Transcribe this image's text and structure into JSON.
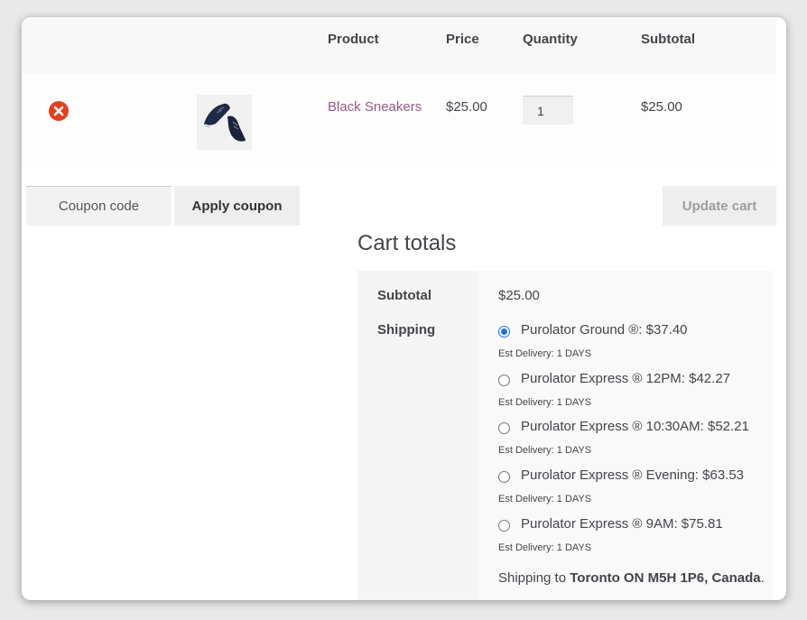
{
  "table": {
    "headers": {
      "product": "Product",
      "price": "Price",
      "quantity": "Quantity",
      "subtotal": "Subtotal"
    },
    "item": {
      "name": "Black Sneakers",
      "price": "$25.00",
      "quantity": "1",
      "subtotal": "$25.00"
    }
  },
  "coupon": {
    "placeholder": "Coupon code",
    "apply_label": "Apply coupon"
  },
  "update_cart_label": "Update cart",
  "cart_totals": {
    "title": "Cart totals",
    "subtotal_label": "Subtotal",
    "subtotal_value": "$25.00",
    "shipping_label": "Shipping",
    "shipping_options": [
      {
        "label": "Purolator Ground ®: $37.40",
        "est": "Est Delivery: 1 DAYS",
        "selected": true
      },
      {
        "label": "Purolator Express ® 12PM: $42.27",
        "est": "Est Delivery: 1 DAYS",
        "selected": false
      },
      {
        "label": "Purolator Express ® 10:30AM: $52.21",
        "est": "Est Delivery: 1 DAYS",
        "selected": false
      },
      {
        "label": "Purolator Express ® Evening: $63.53",
        "est": "Est Delivery: 1 DAYS",
        "selected": false
      },
      {
        "label": "Purolator Express ® 9AM: $75.81",
        "est": "Est Delivery: 1 DAYS",
        "selected": false
      }
    ],
    "shipping_to_prefix": "Shipping to ",
    "shipping_destination": "Toronto ON M5H 1P6, Canada",
    "shipping_to_suffix": "."
  },
  "icons": {
    "remove": "remove-circle-x-icon",
    "product_image": "sneakers-thumbnail"
  },
  "colors": {
    "remove_red": "#e2401c",
    "link_purple": "#96588a",
    "radio_blue": "#1a73e8"
  }
}
